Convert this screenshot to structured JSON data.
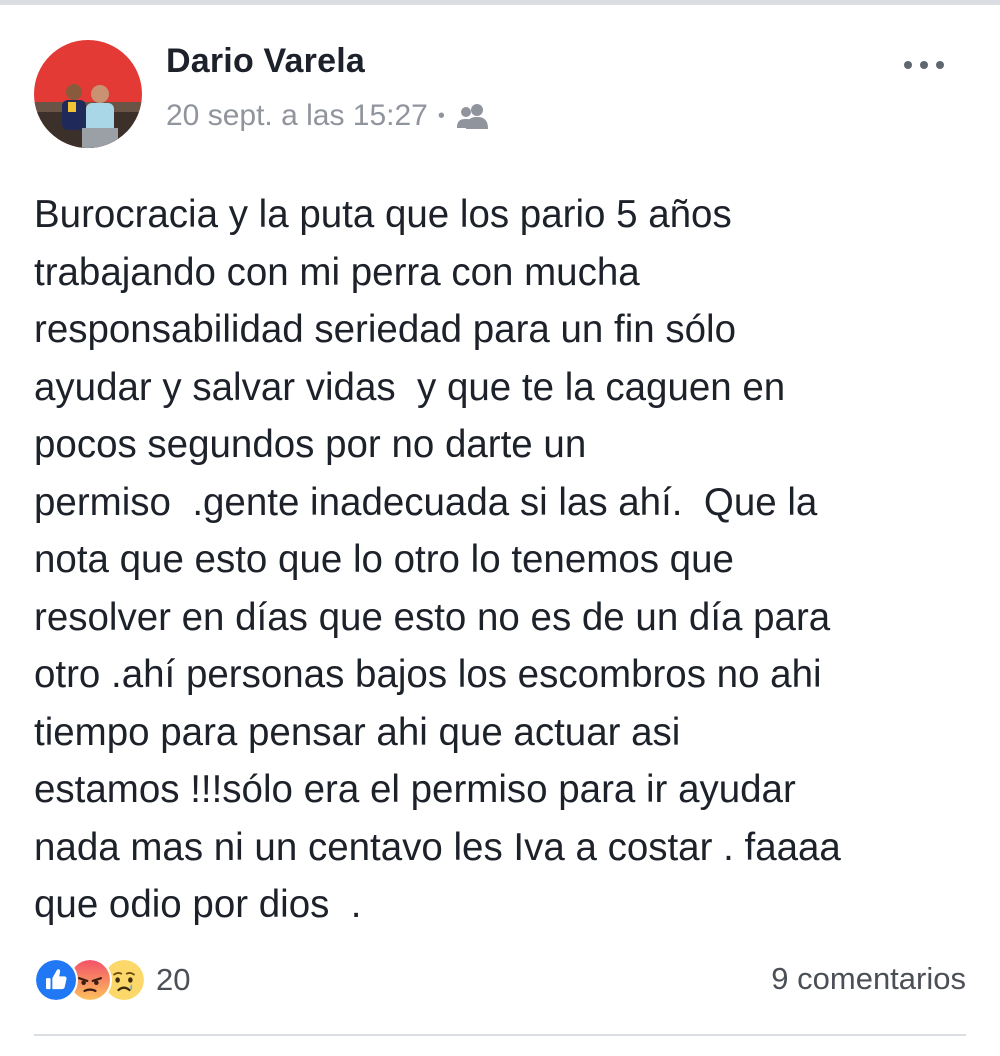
{
  "post": {
    "author": "Dario Varela",
    "timestamp": "20 sept. a las 15:27",
    "separator": "•",
    "audience_icon": "friends-icon",
    "text": "Burocracia y la puta que los pario 5 años\ntrabajando con mi perra con mucha\nresponsabilidad seriedad para un fin sólo\nayudar y salvar vidas  y que te la caguen en\npocos segundos por no darte un\npermiso  .gente inadecuada si las ahí.  Que la\nnota que esto que lo otro lo tenemos que\nresolver en días que esto no es de un día para\notro .ahí personas bajos los escombros no ahi\ntiempo para pensar ahi que actuar asi\nestamos !!!sólo era el permiso para ir ayudar\nnada mas ni un centavo les Iva a costar . faaaa\nque odio por dios  ."
  },
  "footer": {
    "reaction_icons": [
      "like-icon",
      "angry-icon",
      "sad-icon"
    ],
    "reaction_count": "20",
    "comments_label": "9 comentarios"
  },
  "colors": {
    "like_blue": "#2078f4",
    "angry_red": "#f25268",
    "sad_yellow": "#fcd86b",
    "meta_gray": "#90949c"
  }
}
